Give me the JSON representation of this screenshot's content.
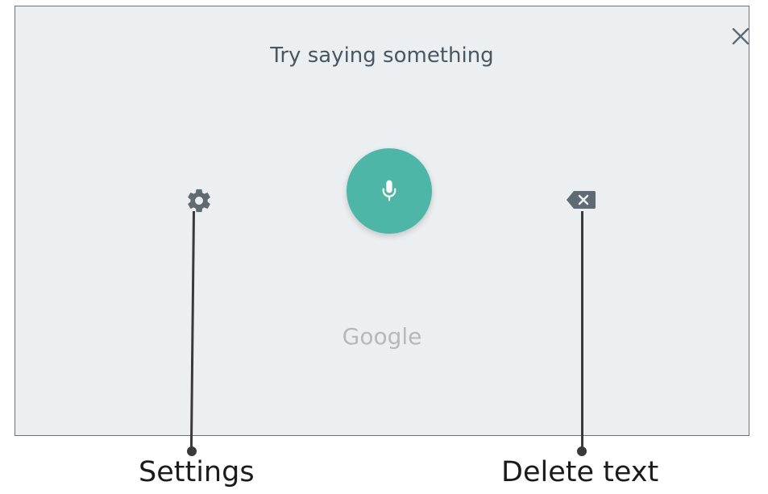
{
  "dialog": {
    "prompt": "Try saying something",
    "brand": "Google",
    "close_icon": "close-icon",
    "mic_icon": "microphone-icon",
    "settings_icon": "gear-icon",
    "delete_icon": "backspace-icon"
  },
  "callouts": {
    "settings_label": "Settings",
    "delete_label": "Delete text"
  },
  "colors": {
    "panel_bg": "#eceff1",
    "mic_accent": "#4db6a6",
    "icon_gray": "#5f6a72",
    "brand_gray": "#b4b9bd",
    "callout_ink": "#3a3a3a"
  }
}
